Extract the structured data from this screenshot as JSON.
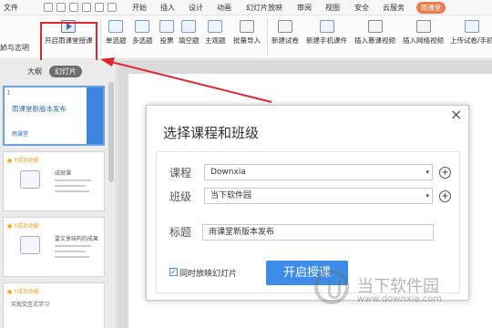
{
  "menubar": {
    "file_label": "文件",
    "tabs": [
      "开始",
      "插入",
      "设计",
      "动画",
      "幻灯片放映",
      "审阅",
      "视图",
      "安全",
      "云服务"
    ],
    "login_label": "雨课堂"
  },
  "ribbon": {
    "user_label": "娇与志明",
    "items": [
      "开启雨课堂授课",
      "单选题",
      "多选题",
      "投票",
      "填空题",
      "主观题",
      "批量导入",
      "新建试卷",
      "新建手机课件",
      "插入慕课视频",
      "插入网络视频",
      "上传试卷/手机"
    ]
  },
  "leftpane": {
    "tab_outline": "大纲",
    "tab_slides": "幻灯片",
    "slides": [
      {
        "num": "1",
        "title": "雨课堂新版本发布",
        "logo": "雨课堂"
      },
      {
        "num": "2",
        "tag": "Y成功功能",
        "heading": "成就课"
      },
      {
        "num": "3",
        "tag": "Y成功功能",
        "heading": "雷文享结构的成果"
      },
      {
        "num": "4",
        "tag": "Y成功功能",
        "heading": "实现交互式学习"
      }
    ]
  },
  "dialog": {
    "title": "选择课程和班级",
    "close_icon": "×",
    "course_label": "课程",
    "course_value": "Downxia",
    "class_label": "班级",
    "class_value": "当下软件园",
    "title_label": "标题",
    "title_value": "雨课堂新版本发布",
    "checkbox_label": "同时放映幻灯片",
    "start_button": "开启授课"
  },
  "watermark": {
    "text": "当下软件园",
    "url": "www.downxia.com"
  }
}
